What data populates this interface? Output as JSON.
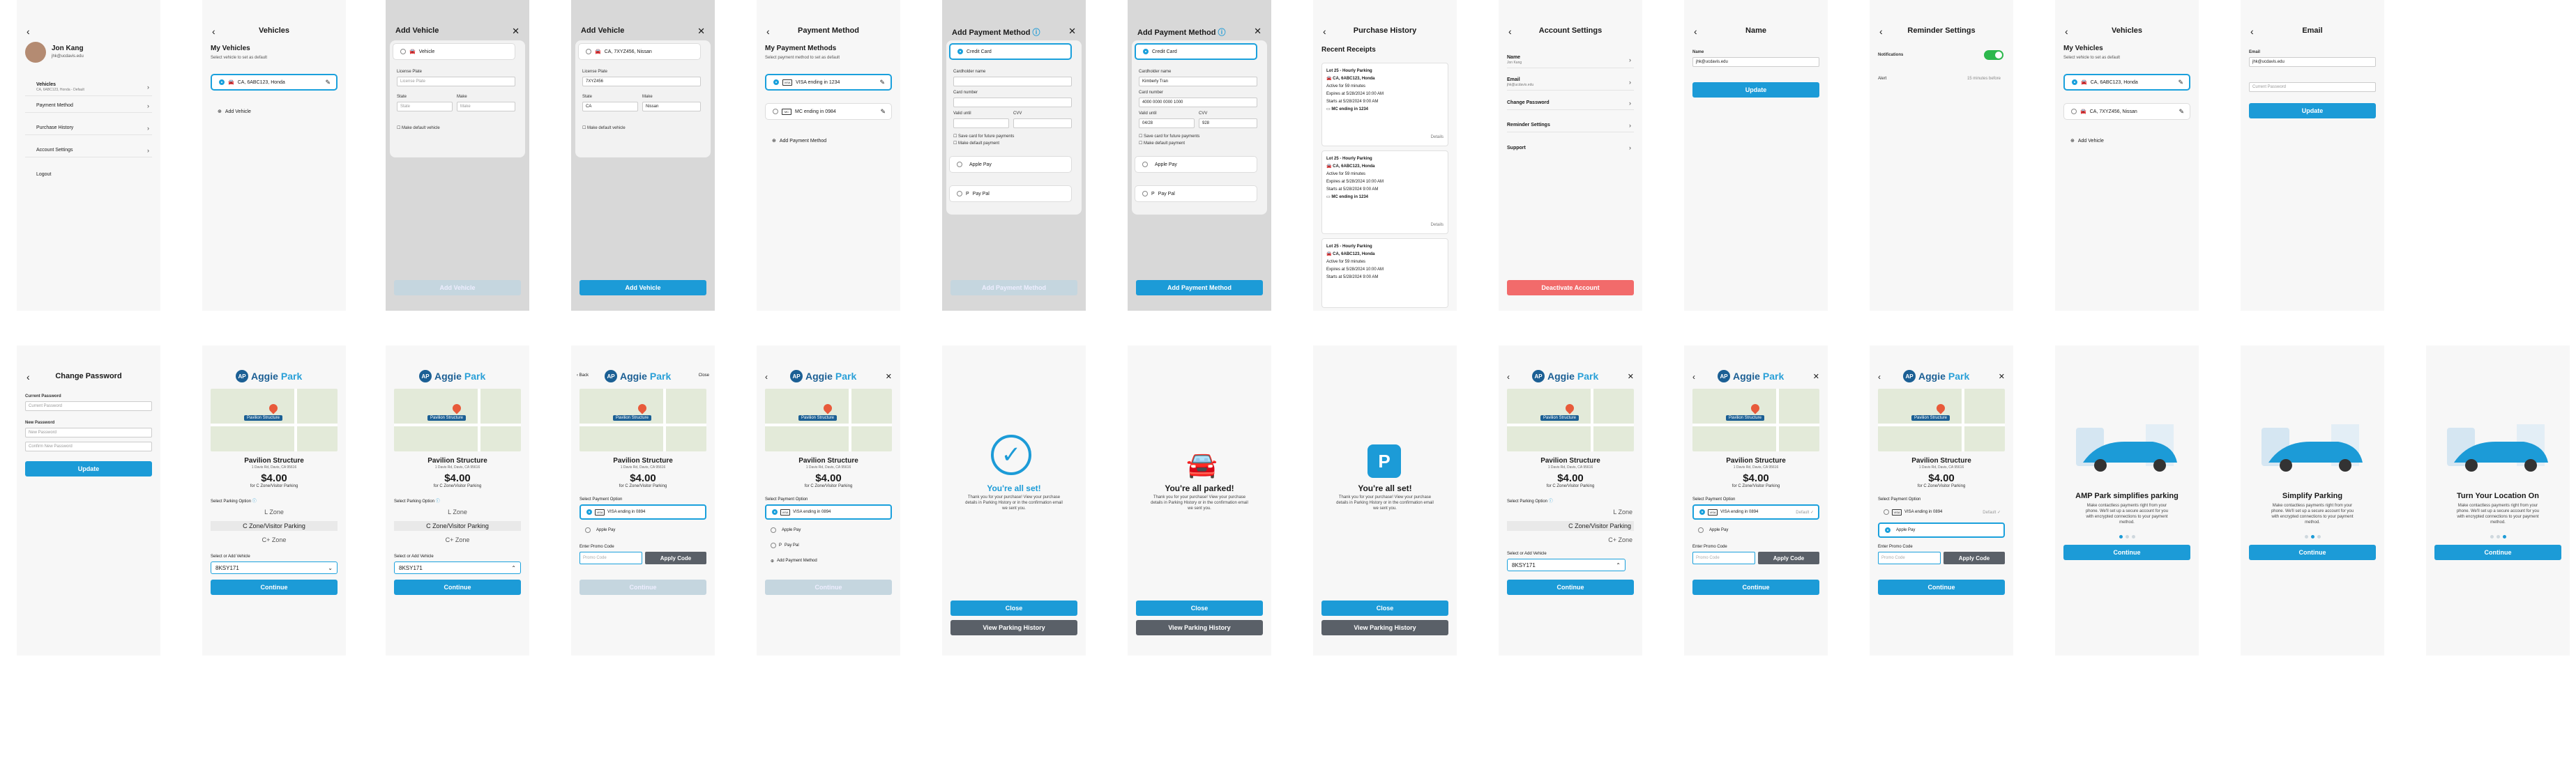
{
  "menu": {
    "user_name": "Jon Kang",
    "user_email": "jhk@ucdavis.edu",
    "items": [
      {
        "label": "Vehicles",
        "sub": "CA, 6ABC123, Honda - Default"
      },
      {
        "label": "Payment Method"
      },
      {
        "label": "Purchase History"
      },
      {
        "label": "Account Settings"
      },
      {
        "label": "Logout"
      }
    ]
  },
  "vehicles": {
    "title": "Vehicles",
    "heading": "My Vehicles",
    "sub": "Select vehicle to set as default",
    "v1": "CA, 6ABC123, Honda",
    "v2": "CA, 7XYZ456, Nissan",
    "add": "Add Vehicle"
  },
  "addvehicle": {
    "title": "Add Vehicle",
    "type": "Vehicle",
    "plate_label": "License Plate",
    "plate_ph": "License Plate",
    "plate_val": "7XYZ456",
    "state_label": "State",
    "make_label": "Make",
    "state_ph": "State",
    "make_ph": "Make",
    "state_val": "CA",
    "make_val": "Nissan",
    "default": "Make default vehicle",
    "button": "Add Vehicle"
  },
  "payment": {
    "title": "Payment Method",
    "heading": "My Payment Methods",
    "sub": "Select payment method to set as default",
    "c1": "VISA ending in 1234",
    "c2": "MC ending in 0984",
    "add": "Add Payment Method"
  },
  "addpayment": {
    "title": "Add Payment Method",
    "credit": "Credit Card",
    "name_label": "Cardholder name",
    "name_val": "Kimberly Tran",
    "num_label": "Card number",
    "num_val": "4000 0000 0000 1000",
    "valid_label": "Valid until",
    "cvv_label": "CVV",
    "valid_val": "04/28",
    "cvv_val": "928",
    "save": "Save card for future payments",
    "default": "Make default payment",
    "apple": "Apple Pay",
    "paypal": "Pay Pal",
    "button": "Add Payment Method"
  },
  "history": {
    "title": "Purchase History",
    "heading": "Recent Receipts",
    "lot": "Lot 25 - Hourly Parking",
    "car": "CA, 6ABC123, Honda",
    "active": "Active for 59 minutes",
    "expires": "Expires at 5/28/2024 10:00 AM",
    "starts": "Starts at 5/28/2024 9:00 AM",
    "card": "MC ending in 1234",
    "details": "Details"
  },
  "settings": {
    "title": "Account Settings",
    "name_label": "Name",
    "name_val": "Jon Kang",
    "email_label": "Email",
    "email_val": "jhk@ucdavis.edu",
    "change_pw": "Change Password",
    "reminder": "Reminder Settings",
    "support": "Support",
    "deactivate": "Deactivate Account"
  },
  "name": {
    "title": "Name",
    "label": "Name",
    "value": "jhk@ucdavis.edu",
    "button": "Update"
  },
  "reminder": {
    "title": "Reminder Settings",
    "notifications": "Notifications",
    "alert": "Alert",
    "alert_val": "15 minutes before"
  },
  "email": {
    "title": "Email",
    "label": "Email",
    "value": "jhk@ucdavis.edu",
    "pw_ph": "Current Password",
    "button": "Update"
  },
  "changepw": {
    "title": "Change Password",
    "current": "Current Password",
    "current_ph": "Current Password",
    "new": "New Password",
    "new_ph": "New Password",
    "confirm_ph": "Confirm New Password",
    "button": "Update"
  },
  "parking": {
    "logo_a": "Aggie",
    "logo_b": "Park",
    "map_tag": "Pavilion Structure",
    "name": "Pavilion Structure",
    "addr": "1 Davis Rd, Davis, CA 95616",
    "price": "$4.00",
    "for": "for C Zone/Visitor Parking",
    "opt_label": "Select Parking Option",
    "z1": "L Zone",
    "z2": "C Zone/Visitor Parking",
    "z3": "C+ Zone",
    "veh_label": "Select or Add Vehicle",
    "veh_val": "8KSY171",
    "pay_label": "Select Payment Option",
    "visa": "VISA ending in 0894",
    "apple": "Apple Pay",
    "paypal": "Pay Pal",
    "addpm": "Add Payment Method",
    "promo_label": "Enter Promo Code",
    "promo_ph": "Promo Code",
    "apply": "Apply Code",
    "continue": "Continue",
    "back": "Back",
    "close": "Close",
    "default": "Default"
  },
  "done": {
    "t1": "You're all set!",
    "t2": "You're all parked!",
    "t3": "You're all set!",
    "msg": "Thank you for your purchase! View your purchase details in Parking History or in the confirmation email we sent you.",
    "close": "Close",
    "history": "View Parking History"
  },
  "onboard": {
    "t1": "AMP Park simplifies parking",
    "t2": "Simplify Parking",
    "t3": "Turn Your Location On",
    "d": "Make contactless payments right from your phone. We'll set up a secure account for you with encrypted connections to your payment method.",
    "btn": "Continue"
  }
}
